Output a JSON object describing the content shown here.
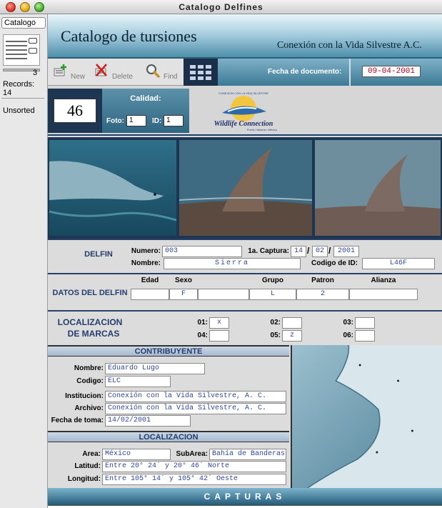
{
  "window": {
    "title": "Catalogo Delfines"
  },
  "status_area": {
    "layout": "Catalogo",
    "current_record": "3",
    "records_label": "Records:",
    "records_value": "14",
    "sort_state": "Unsorted"
  },
  "header": {
    "title": "Catalogo de tursiones",
    "organization": "Conexión con la Vida Silvestre A.C."
  },
  "toolbar": {
    "new_label": "New",
    "delete_label": "Delete",
    "find_label": "Find",
    "doc_date_label": "Fecha de documento:",
    "doc_date_value": "09-04-2001"
  },
  "record": {
    "number": "46",
    "quality_title": "Calidad:",
    "foto_label": "Foto:",
    "foto_value": "1",
    "id_label": "ID:",
    "id_value": "1",
    "logo_text": "Wildlife Connection",
    "logo_top_text": "CONEXION CON LA VIDA SILVESTRE",
    "logo_bottom_text": "Puerto Vallarta • México"
  },
  "delfin": {
    "section_title": "DELFIN",
    "numero_label": "Numero:",
    "numero_value": "003",
    "captura_label": "1a. Captura:",
    "captura_day": "14",
    "captura_month": "02",
    "captura_year": "2001",
    "nombre_label": "Nombre:",
    "nombre_value": "Sierra",
    "codigo_label": "Codigo de ID:",
    "codigo_value": "L46F"
  },
  "datos": {
    "section_title": "DATOS DEL DELFIN",
    "headers": [
      "Edad",
      "Sexo",
      "Grupo",
      "Patron",
      "Alianza"
    ],
    "edad": "",
    "sexo": "F",
    "grupo": "L",
    "patron": "2",
    "alianza": ""
  },
  "marcas": {
    "section_title_1": "LOCALIZACION",
    "section_title_2": "DE MARCAS",
    "labels": [
      "01:",
      "02:",
      "03:",
      "04:",
      "05:",
      "06:"
    ],
    "values": [
      "x",
      "",
      "",
      "",
      "z",
      ""
    ]
  },
  "contribuyente": {
    "section_title": "CONTRIBUYENTE",
    "nombre_label": "Nombre:",
    "nombre_value": "Eduardo Lugo",
    "codigo_label": "Codigo:",
    "codigo_value": "ELC",
    "institucion_label": "Institucion:",
    "institucion_value": "Conexión con la Vida Silvestre, A. C.",
    "archivo_label": "Archivo:",
    "archivo_value": "Conexión con la Vida Silvestre, A. C.",
    "fecha_label": "Fecha de toma:",
    "fecha_value": "14/02/2001"
  },
  "localizacion": {
    "section_title": "LOCALIZACION",
    "area_label": "Area:",
    "area_value": "México",
    "subarea_label": "SubArea:",
    "subarea_value": "Bahía de Banderas",
    "latitud_label": "Latitud:",
    "latitud_value": "Entre 20° 24´ y 20° 46´ Norte",
    "longitud_label": "Longitud:",
    "longitud_value": "Entre 105° 14´ y 105° 42´ Oeste"
  },
  "capturas": {
    "title": "CAPTURAS"
  },
  "colors": {
    "header_dark": "#1d3654",
    "accent_blue": "#2f46a0",
    "date_red": "#b00020"
  }
}
